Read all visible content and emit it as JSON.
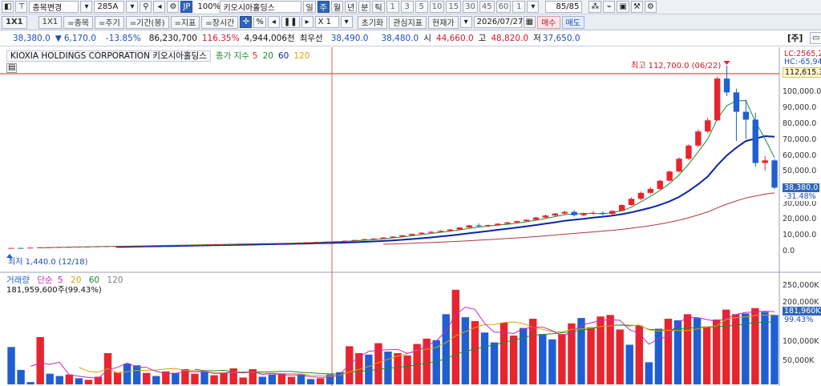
{
  "toolbar1": {
    "stock_change_label": "종목변경",
    "stock_code": "285A",
    "exchange_badge": "JP",
    "zoom": "100%",
    "stock_name": "키오시아홀딩스",
    "periods": [
      "일",
      "주",
      "월",
      "년",
      "분",
      "틱"
    ],
    "active_period": "주",
    "intervals": [
      "1",
      "3",
      "5",
      "10",
      "15",
      "30",
      "45",
      "60",
      "1"
    ],
    "page_counter": "85/85"
  },
  "toolbar2": {
    "layout_1": "1X1",
    "layout_2": "1X1",
    "items_btn": "=종목",
    "period_btn": "=주기",
    "range_btn": "=기간(봉)",
    "indicator_btn": "=지표",
    "extended_btn": "=장시간",
    "percent": "%",
    "multiplier": "X 1",
    "reset_label": "초기화",
    "interest_label": "관심지표",
    "price_mode": "현재가",
    "date": "2026/07/27",
    "buy_label": "매수",
    "sell_label": "매도"
  },
  "quote": {
    "price": "38,380.0",
    "change_arrow": "▼",
    "change": "6,170.0",
    "change_pct": "-13.85%",
    "volume": "86,230,700",
    "volume_ratio": "116.35%",
    "amount": "4,944,006천",
    "best_bid_label": "최우선",
    "best_bid": "38,490.0",
    "best_ask": "38,480.0",
    "open_label": "시",
    "open": "44,660.0",
    "high_label": "고",
    "high": "48,820.0",
    "low_label": "저",
    "low": "37,650.0",
    "panel_tab": "[주]"
  },
  "price_panel": {
    "company": "KIOXIA HOLDINGS CORPORATION",
    "company_kr": "키오시아홀딩스",
    "ma_label": "종가 지수",
    "ma_periods": [
      "5",
      "20",
      "60",
      "120"
    ],
    "high_annotation": "최고 112,700.0 (06/22)",
    "low_annotation": "최저 1,440.0 (12/18)",
    "lc_label": "LC:2565,28",
    "hc_label": "HC:-65,94",
    "line_value": "112,615.3",
    "last_price_tag": "38,380.0",
    "last_pct_tag": "-31.48%",
    "y_axis": [
      "100,000.0",
      "90,000.0",
      "80,000.0",
      "70,000.0",
      "60,000.0",
      "50,000.0",
      "40,000.0",
      "30,000.0",
      "20,000.0",
      "10,000.0",
      "0.0"
    ]
  },
  "volume_panel": {
    "legend_title": "거래량",
    "legend_type": "단순",
    "ma_periods": [
      "5",
      "20",
      "60",
      "120"
    ],
    "current_volume": "181,959,600주(99.43%)",
    "last_tag": "181,960K",
    "pct_tag": "99.43%",
    "y_axis": [
      "250,000K",
      "200,000K",
      "150,000K",
      "100,000K",
      "50,000K"
    ]
  },
  "colors": {
    "up": "#e8242f",
    "down": "#1f5fd1",
    "ma5": "#e8242f",
    "ma20": "#1f8a2d",
    "ma60": "#0a24a8",
    "ma120": "#b6353a",
    "vma5": "#c427c4",
    "vma20": "#d9a300",
    "vma60": "#1f8a2d",
    "vma120": "#808080"
  },
  "chart_data": {
    "type": "candlestick",
    "note_x": "weekly candles, oldest to newest",
    "candles": [
      [
        1440,
        1700,
        1400,
        1650
      ],
      [
        1650,
        1800,
        1500,
        1600
      ],
      [
        1600,
        1900,
        1550,
        1850
      ],
      [
        1850,
        2100,
        1800,
        2000
      ],
      [
        2000,
        2200,
        1900,
        2100
      ],
      [
        2100,
        2300,
        2000,
        2200
      ],
      [
        2200,
        2400,
        2100,
        2300
      ],
      [
        2300,
        2500,
        2200,
        2400
      ],
      [
        2400,
        2600,
        2300,
        2450
      ],
      [
        2450,
        2700,
        2400,
        2600
      ],
      [
        2600,
        2800,
        2500,
        2700
      ],
      [
        2700,
        2900,
        2600,
        2800
      ],
      [
        2800,
        3000,
        2700,
        2900
      ],
      [
        2900,
        3100,
        2800,
        3000
      ],
      [
        3000,
        3200,
        2900,
        3100
      ],
      [
        3100,
        3300,
        3000,
        3200
      ],
      [
        3200,
        3400,
        3100,
        3300
      ],
      [
        3300,
        3500,
        3200,
        3400
      ],
      [
        3400,
        3600,
        3300,
        3500
      ],
      [
        3500,
        3700,
        3400,
        3600
      ],
      [
        3600,
        3800,
        3500,
        3700
      ],
      [
        3700,
        3900,
        3600,
        3800
      ],
      [
        3800,
        4000,
        3700,
        3900
      ],
      [
        3900,
        4200,
        3800,
        4100
      ],
      [
        4100,
        4300,
        4000,
        4200
      ],
      [
        4200,
        4400,
        4100,
        4300
      ],
      [
        4300,
        4500,
        4200,
        4400
      ],
      [
        4400,
        4600,
        4300,
        4500
      ],
      [
        4500,
        4700,
        4400,
        4600
      ],
      [
        4600,
        4800,
        4500,
        4700
      ],
      [
        4700,
        5000,
        4600,
        4900
      ],
      [
        4900,
        5200,
        4800,
        5100
      ],
      [
        5100,
        5400,
        5000,
        5300
      ],
      [
        5300,
        5600,
        5200,
        5500
      ],
      [
        5500,
        5800,
        5400,
        5700
      ],
      [
        5700,
        6200,
        5600,
        6100
      ],
      [
        6100,
        6600,
        6000,
        6500
      ],
      [
        6500,
        7200,
        6400,
        7000
      ],
      [
        7000,
        7600,
        6900,
        7400
      ],
      [
        7400,
        8200,
        7300,
        8000
      ],
      [
        8000,
        8800,
        7800,
        8600
      ],
      [
        8600,
        9600,
        8400,
        9400
      ],
      [
        9400,
        10400,
        9200,
        10200
      ],
      [
        10200,
        11200,
        9800,
        10900
      ],
      [
        10900,
        11800,
        10600,
        11500
      ],
      [
        11500,
        12400,
        11200,
        12100
      ],
      [
        12100,
        13200,
        11800,
        12900
      ],
      [
        12900,
        14400,
        12600,
        14100
      ],
      [
        14100,
        15800,
        13800,
        15400
      ],
      [
        15400,
        16600,
        14500,
        14900
      ],
      [
        14900,
        15900,
        14400,
        15600
      ],
      [
        15600,
        16800,
        15200,
        16400
      ],
      [
        16400,
        17600,
        16000,
        17200
      ],
      [
        17200,
        18400,
        16800,
        18000
      ],
      [
        18000,
        19200,
        17400,
        18800
      ],
      [
        18800,
        20600,
        18400,
        20200
      ],
      [
        20200,
        22000,
        19600,
        21400
      ],
      [
        21400,
        23000,
        20800,
        22600
      ],
      [
        22600,
        24400,
        21600,
        23600
      ],
      [
        23600,
        24600,
        20800,
        21600
      ],
      [
        21600,
        23200,
        21000,
        22800
      ],
      [
        22800,
        24200,
        21800,
        23000
      ],
      [
        23000,
        24000,
        21600,
        22400
      ],
      [
        22400,
        24600,
        22000,
        24200
      ],
      [
        24200,
        28200,
        24000,
        27800
      ],
      [
        27800,
        32400,
        27400,
        31600
      ],
      [
        31600,
        36000,
        30800,
        35200
      ],
      [
        35200,
        38600,
        34400,
        37600
      ],
      [
        37600,
        43200,
        37200,
        42600
      ],
      [
        42600,
        48800,
        42000,
        48200
      ],
      [
        48200,
        56800,
        47600,
        56000
      ],
      [
        56000,
        64800,
        55200,
        64000
      ],
      [
        64000,
        73800,
        63000,
        72600
      ],
      [
        72600,
        81000,
        71400,
        79400
      ],
      [
        79400,
        106000,
        79000,
        104800
      ],
      [
        104800,
        112700,
        94200,
        96400
      ],
      [
        96400,
        98600,
        66800,
        84600
      ],
      [
        84600,
        92000,
        68000,
        79800
      ],
      [
        79800,
        84000,
        51000,
        53400
      ],
      [
        53400,
        57600,
        48800,
        55000
      ],
      [
        55000,
        56000,
        37650,
        38380
      ]
    ],
    "ylim": [
      0,
      120000
    ],
    "volume": [
      [
        98000,
        "d"
      ],
      [
        38000,
        "d"
      ],
      [
        6000,
        "d"
      ],
      [
        124000,
        "u"
      ],
      [
        28000,
        "d"
      ],
      [
        22000,
        "d"
      ],
      [
        26000,
        "u"
      ],
      [
        16000,
        "d"
      ],
      [
        12000,
        "u"
      ],
      [
        20000,
        "u"
      ],
      [
        82000,
        "u"
      ],
      [
        32000,
        "u"
      ],
      [
        54000,
        "d"
      ],
      [
        50000,
        "d"
      ],
      [
        30000,
        "u"
      ],
      [
        22000,
        "d"
      ],
      [
        34000,
        "u"
      ],
      [
        30000,
        "d"
      ],
      [
        40000,
        "u"
      ],
      [
        28000,
        "u"
      ],
      [
        34000,
        "d"
      ],
      [
        24000,
        "u"
      ],
      [
        30000,
        "u"
      ],
      [
        42000,
        "u"
      ],
      [
        18000,
        "u"
      ],
      [
        40000,
        "u"
      ],
      [
        20000,
        "d"
      ],
      [
        26000,
        "d"
      ],
      [
        28000,
        "u"
      ],
      [
        20000,
        "u"
      ],
      [
        26000,
        "d"
      ],
      [
        14000,
        "d"
      ],
      [
        16000,
        "u"
      ],
      [
        26000,
        "d"
      ],
      [
        32000,
        "d"
      ],
      [
        100000,
        "u"
      ],
      [
        82000,
        "u"
      ],
      [
        78000,
        "d"
      ],
      [
        108000,
        "u"
      ],
      [
        86000,
        "d"
      ],
      [
        82000,
        "u"
      ],
      [
        76000,
        "u"
      ],
      [
        106000,
        "u"
      ],
      [
        120000,
        "u"
      ],
      [
        116000,
        "d"
      ],
      [
        184000,
        "d"
      ],
      [
        248000,
        "u"
      ],
      [
        176000,
        "d"
      ],
      [
        166000,
        "u"
      ],
      [
        136000,
        "d"
      ],
      [
        110000,
        "d"
      ],
      [
        162000,
        "u"
      ],
      [
        128000,
        "u"
      ],
      [
        148000,
        "d"
      ],
      [
        172000,
        "u"
      ],
      [
        132000,
        "d"
      ],
      [
        118000,
        "d"
      ],
      [
        132000,
        "u"
      ],
      [
        160000,
        "u"
      ],
      [
        174000,
        "d"
      ],
      [
        150000,
        "u"
      ],
      [
        178000,
        "u"
      ],
      [
        182000,
        "u"
      ],
      [
        144000,
        "u"
      ],
      [
        104000,
        "d"
      ],
      [
        154000,
        "u"
      ],
      [
        58000,
        "d"
      ],
      [
        146000,
        "d"
      ],
      [
        172000,
        "u"
      ],
      [
        168000,
        "d"
      ],
      [
        184000,
        "u"
      ],
      [
        174000,
        "d"
      ],
      [
        152000,
        "u"
      ],
      [
        170000,
        "u"
      ],
      [
        196000,
        "u"
      ],
      [
        184000,
        "u"
      ],
      [
        186000,
        "d"
      ],
      [
        200000,
        "u"
      ],
      [
        190000,
        "d"
      ],
      [
        181960,
        "d"
      ]
    ],
    "vlim": [
      0,
      275000
    ]
  }
}
